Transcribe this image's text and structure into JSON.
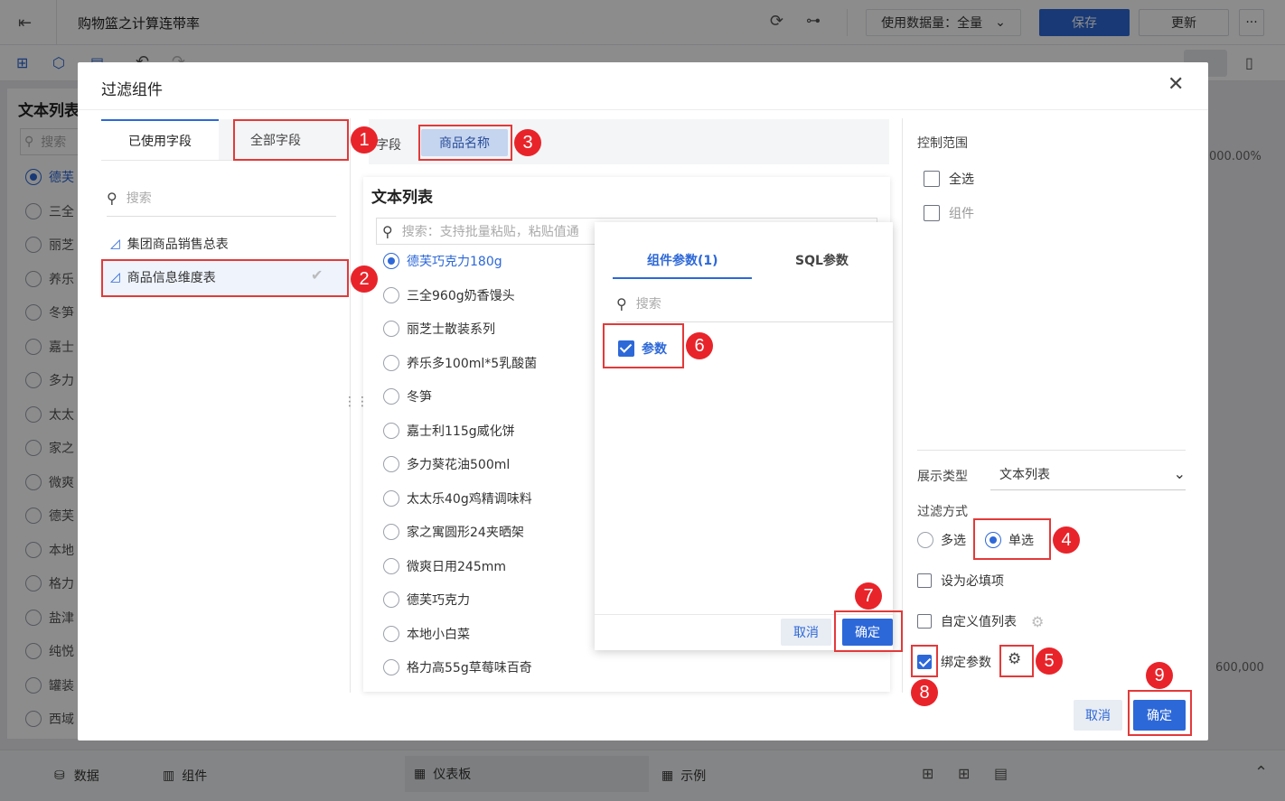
{
  "app": {
    "title": "购物篮之计算连带率",
    "data_amount_label": "使用数据量：全量",
    "save_label": "保存",
    "update_label": "更新",
    "more_label": "···"
  },
  "background": {
    "panel_title": "文本列表",
    "search_placeholder": "搜索",
    "items": [
      "德芙",
      "三全",
      "丽芝",
      "养乐",
      "冬笋",
      "嘉士",
      "多力",
      "太太",
      "家之",
      "微爽",
      "德芙",
      "本地",
      "格力",
      "盐津",
      "纯悦",
      "罐装",
      "西域"
    ],
    "right_value_top": "000.00%",
    "right_value_bottom": "600,000"
  },
  "bottom_tabs": {
    "data": "数据",
    "component": "组件",
    "dashboard": "仪表板",
    "example": "示例"
  },
  "dialog": {
    "title": "过滤组件",
    "tab_used": "已使用字段",
    "tab_all": "全部字段",
    "field_search_placeholder": "搜索",
    "tables": [
      "集团商品销售总表",
      "商品信息维度表"
    ],
    "field_label": "字段",
    "field_tag": "商品名称",
    "preview_title": "文本列表",
    "preview_search_placeholder": "搜索：支持批量粘贴，粘贴值通",
    "preview_items": [
      "德芙巧克力180g",
      "三全960g奶香馒头",
      "丽芝士散装系列",
      "养乐多100ml*5乳酸菌",
      "冬笋",
      "嘉士利115g威化饼",
      "多力葵花油500ml",
      "太太乐40g鸡精调味料",
      "家之寓圆形24夹晒架",
      "微爽日用245mm",
      "德芙巧克力",
      "本地小白菜",
      "格力高55g草莓味百奇"
    ],
    "popup": {
      "tab_component_params": "组件参数(1)",
      "tab_sql_params": "SQL参数",
      "search_placeholder": "搜索",
      "param_label": "参数",
      "cancel": "取消",
      "confirm": "确定"
    },
    "right": {
      "control_scope": "控制范围",
      "select_all": "全选",
      "component": "组件",
      "display_type_label": "展示类型",
      "display_type_value": "文本列表",
      "filter_mode_label": "过滤方式",
      "multi": "多选",
      "single": "单选",
      "required": "设为必填项",
      "custom_list": "自定义值列表",
      "bind_param": "绑定参数"
    },
    "cancel": "取消",
    "confirm": "确定"
  },
  "badges": [
    "1",
    "2",
    "3",
    "4",
    "5",
    "6",
    "7",
    "8",
    "9"
  ],
  "colors": {
    "accent": "#2d68d8",
    "marker": "#e8242a"
  }
}
